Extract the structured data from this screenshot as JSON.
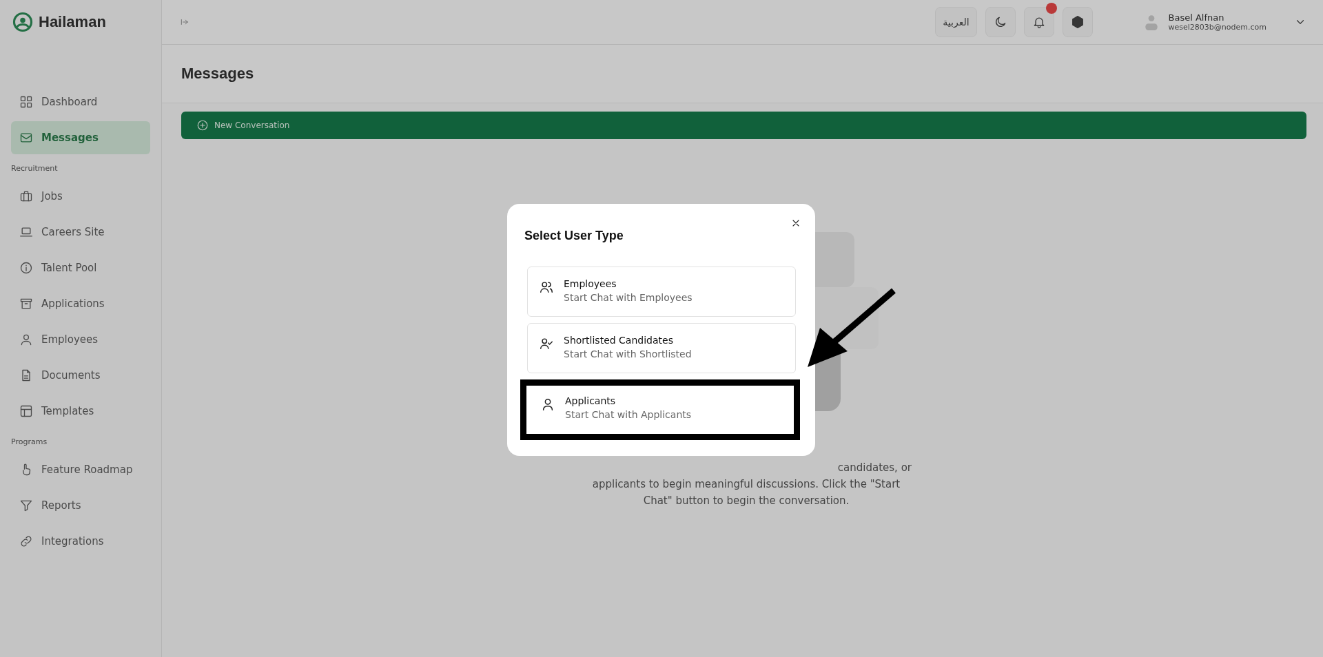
{
  "sidebar": {
    "logo": "Hailaman",
    "sections": [
      {
        "items": [
          {
            "label": "Dashboard",
            "selected": false
          },
          {
            "label": "Messages",
            "selected": true
          }
        ]
      },
      {
        "heading": "Recruitment",
        "items": [
          {
            "label": "Jobs",
            "selected": false
          },
          {
            "label": "Careers Site",
            "selected": false
          },
          {
            "label": "Talent Pool",
            "selected": false
          },
          {
            "label": "Applications",
            "selected": false
          },
          {
            "label": "Employees",
            "selected": false
          },
          {
            "label": "Documents",
            "selected": false
          },
          {
            "label": "Templates",
            "selected": false
          }
        ]
      },
      {
        "heading": "Programs",
        "items": [
          {
            "label": "Feature Roadmap",
            "selected": false
          },
          {
            "label": "Reports",
            "selected": false
          },
          {
            "label": "Integrations",
            "selected": false
          }
        ]
      }
    ]
  },
  "top_bar": {
    "language_button": "العربية",
    "notification_badge": true,
    "user": {
      "name": "Basel Alfnan",
      "email": "wesel2803b@nodem.com"
    }
  },
  "page": {
    "title": "Messages",
    "new_conversation_button": "New Conversation",
    "empty_state_lines": [
      "candidates, or",
      "applicants to begin meaningful discussions. Click the \"Start",
      "Chat\" button to begin the conversation."
    ]
  },
  "modal": {
    "title": "Select User Type",
    "options": [
      {
        "title": "Employees",
        "subtitle": "Start Chat with Employees",
        "highlighted": false
      },
      {
        "title": "Shortlisted Candidates",
        "subtitle": "Start Chat with Shortlisted",
        "highlighted": false
      },
      {
        "title": "Applicants",
        "subtitle": "Start Chat with Applicants",
        "highlighted": true
      }
    ]
  }
}
